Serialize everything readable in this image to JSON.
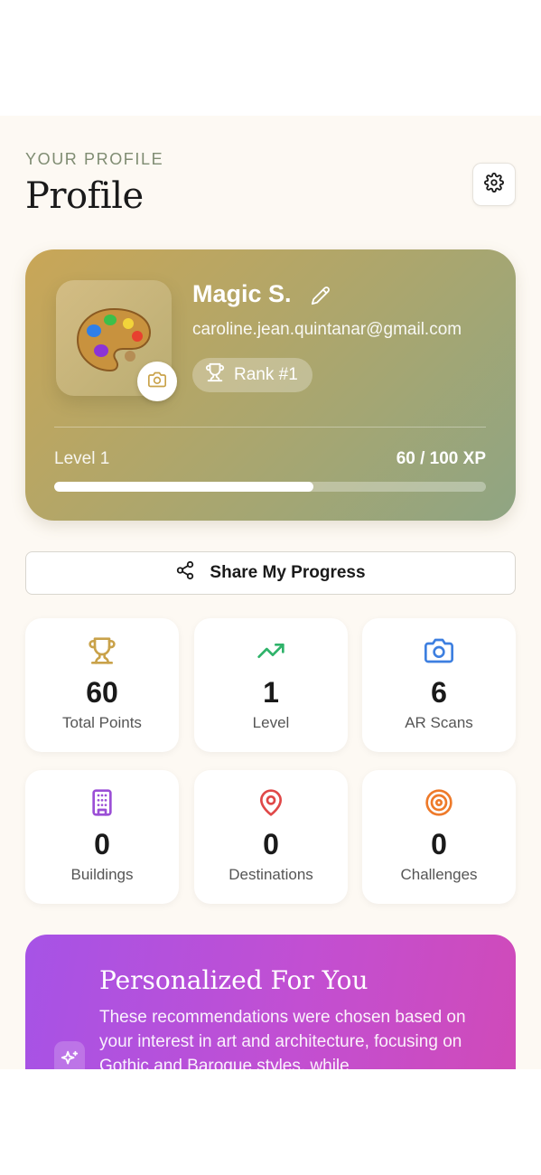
{
  "header": {
    "eyebrow": "YOUR PROFILE",
    "title": "Profile",
    "settings_icon": "gear-icon"
  },
  "profile": {
    "name": "Magic S.",
    "email": "caroline.jean.quintanar@gmail.com",
    "rank": "Rank #1",
    "avatar_icon": "artist-palette-icon",
    "level_label": "Level 1",
    "xp_label": "60 / 100 XP",
    "xp_progress": 0.6
  },
  "share": {
    "label": "Share My Progress"
  },
  "stats": [
    {
      "value": "60",
      "label": "Total Points",
      "icon": "trophy-icon",
      "color": "#c9a24a"
    },
    {
      "value": "1",
      "label": "Level",
      "icon": "trending-up-icon",
      "color": "#2fb36a"
    },
    {
      "value": "6",
      "label": "AR Scans",
      "icon": "camera-icon",
      "color": "#3d7fe0"
    },
    {
      "value": "0",
      "label": "Buildings",
      "icon": "building-icon",
      "color": "#9b4fd6"
    },
    {
      "value": "0",
      "label": "Destinations",
      "icon": "map-pin-icon",
      "color": "#e04848"
    },
    {
      "value": "0",
      "label": "Challenges",
      "icon": "target-icon",
      "color": "#ee7a2a"
    }
  ],
  "recommendations": {
    "title": "Personalized For You",
    "text": "These recommendations were chosen based on your interest in art and architecture, focusing on Gothic and Baroque styles, while"
  },
  "colors": {
    "background": "#fdf9f3",
    "hero_start": "#c9a657",
    "hero_end": "#8fa583",
    "promo_start": "#a653e6",
    "promo_end": "#d04ab8"
  }
}
